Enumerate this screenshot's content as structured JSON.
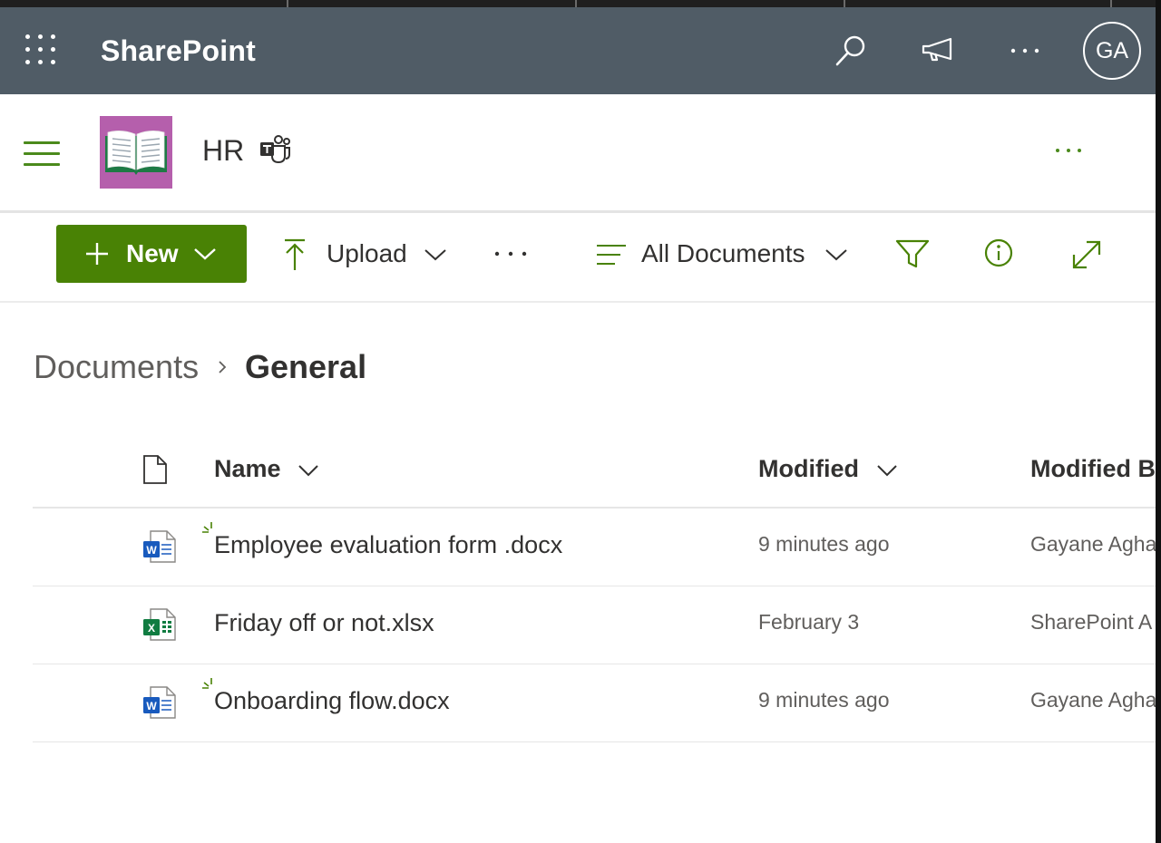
{
  "suite_bar": {
    "app_name": "SharePoint",
    "user_initials": "GA",
    "background_color": "#505c66"
  },
  "site": {
    "title": "HR",
    "logo_color": "#b55fac",
    "accent_color": "#498205"
  },
  "command_bar": {
    "new_label": "New",
    "upload_label": "Upload",
    "view_label": "All Documents"
  },
  "breadcrumb": {
    "root": "Documents",
    "current": "General"
  },
  "list": {
    "columns": [
      "Name",
      "Modified",
      "Modified B"
    ],
    "rows": [
      {
        "name": "Employee evaluation form .docx",
        "modified": "9 minutes ago",
        "modified_by": "Gayane Agha",
        "type": "word",
        "is_new": true
      },
      {
        "name": "Friday off or not.xlsx",
        "modified": "February 3",
        "modified_by": "SharePoint A",
        "type": "excel",
        "is_new": false
      },
      {
        "name": "Onboarding flow.docx",
        "modified": "9 minutes ago",
        "modified_by": "Gayane Agha",
        "type": "word",
        "is_new": true
      }
    ]
  }
}
